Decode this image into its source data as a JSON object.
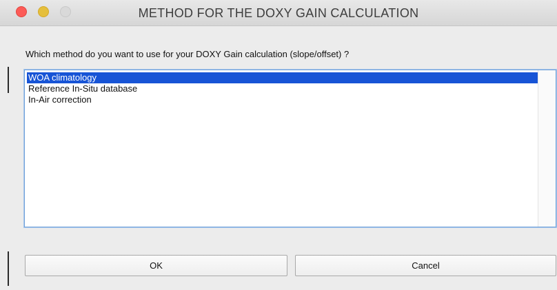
{
  "window": {
    "title": "METHOD FOR THE DOXY GAIN CALCULATION",
    "controls": [
      "close-icon",
      "minimize-icon",
      "zoom-icon"
    ],
    "colors": {
      "close": "#fc5b57",
      "minimize": "#e5bf3c",
      "zoom": "#d9d9d9",
      "selection": "#1754d6",
      "list_border": "#6fa0d8"
    }
  },
  "dialog": {
    "prompt": "Which method do you want to use for your DOXY Gain calculation (slope/offset) ?",
    "options": [
      {
        "label": "WOA climatology",
        "selected": true
      },
      {
        "label": "Reference In-Situ database",
        "selected": false
      },
      {
        "label": "In-Air correction",
        "selected": false
      }
    ],
    "buttons": {
      "ok_label": "OK",
      "cancel_label": "Cancel"
    }
  }
}
